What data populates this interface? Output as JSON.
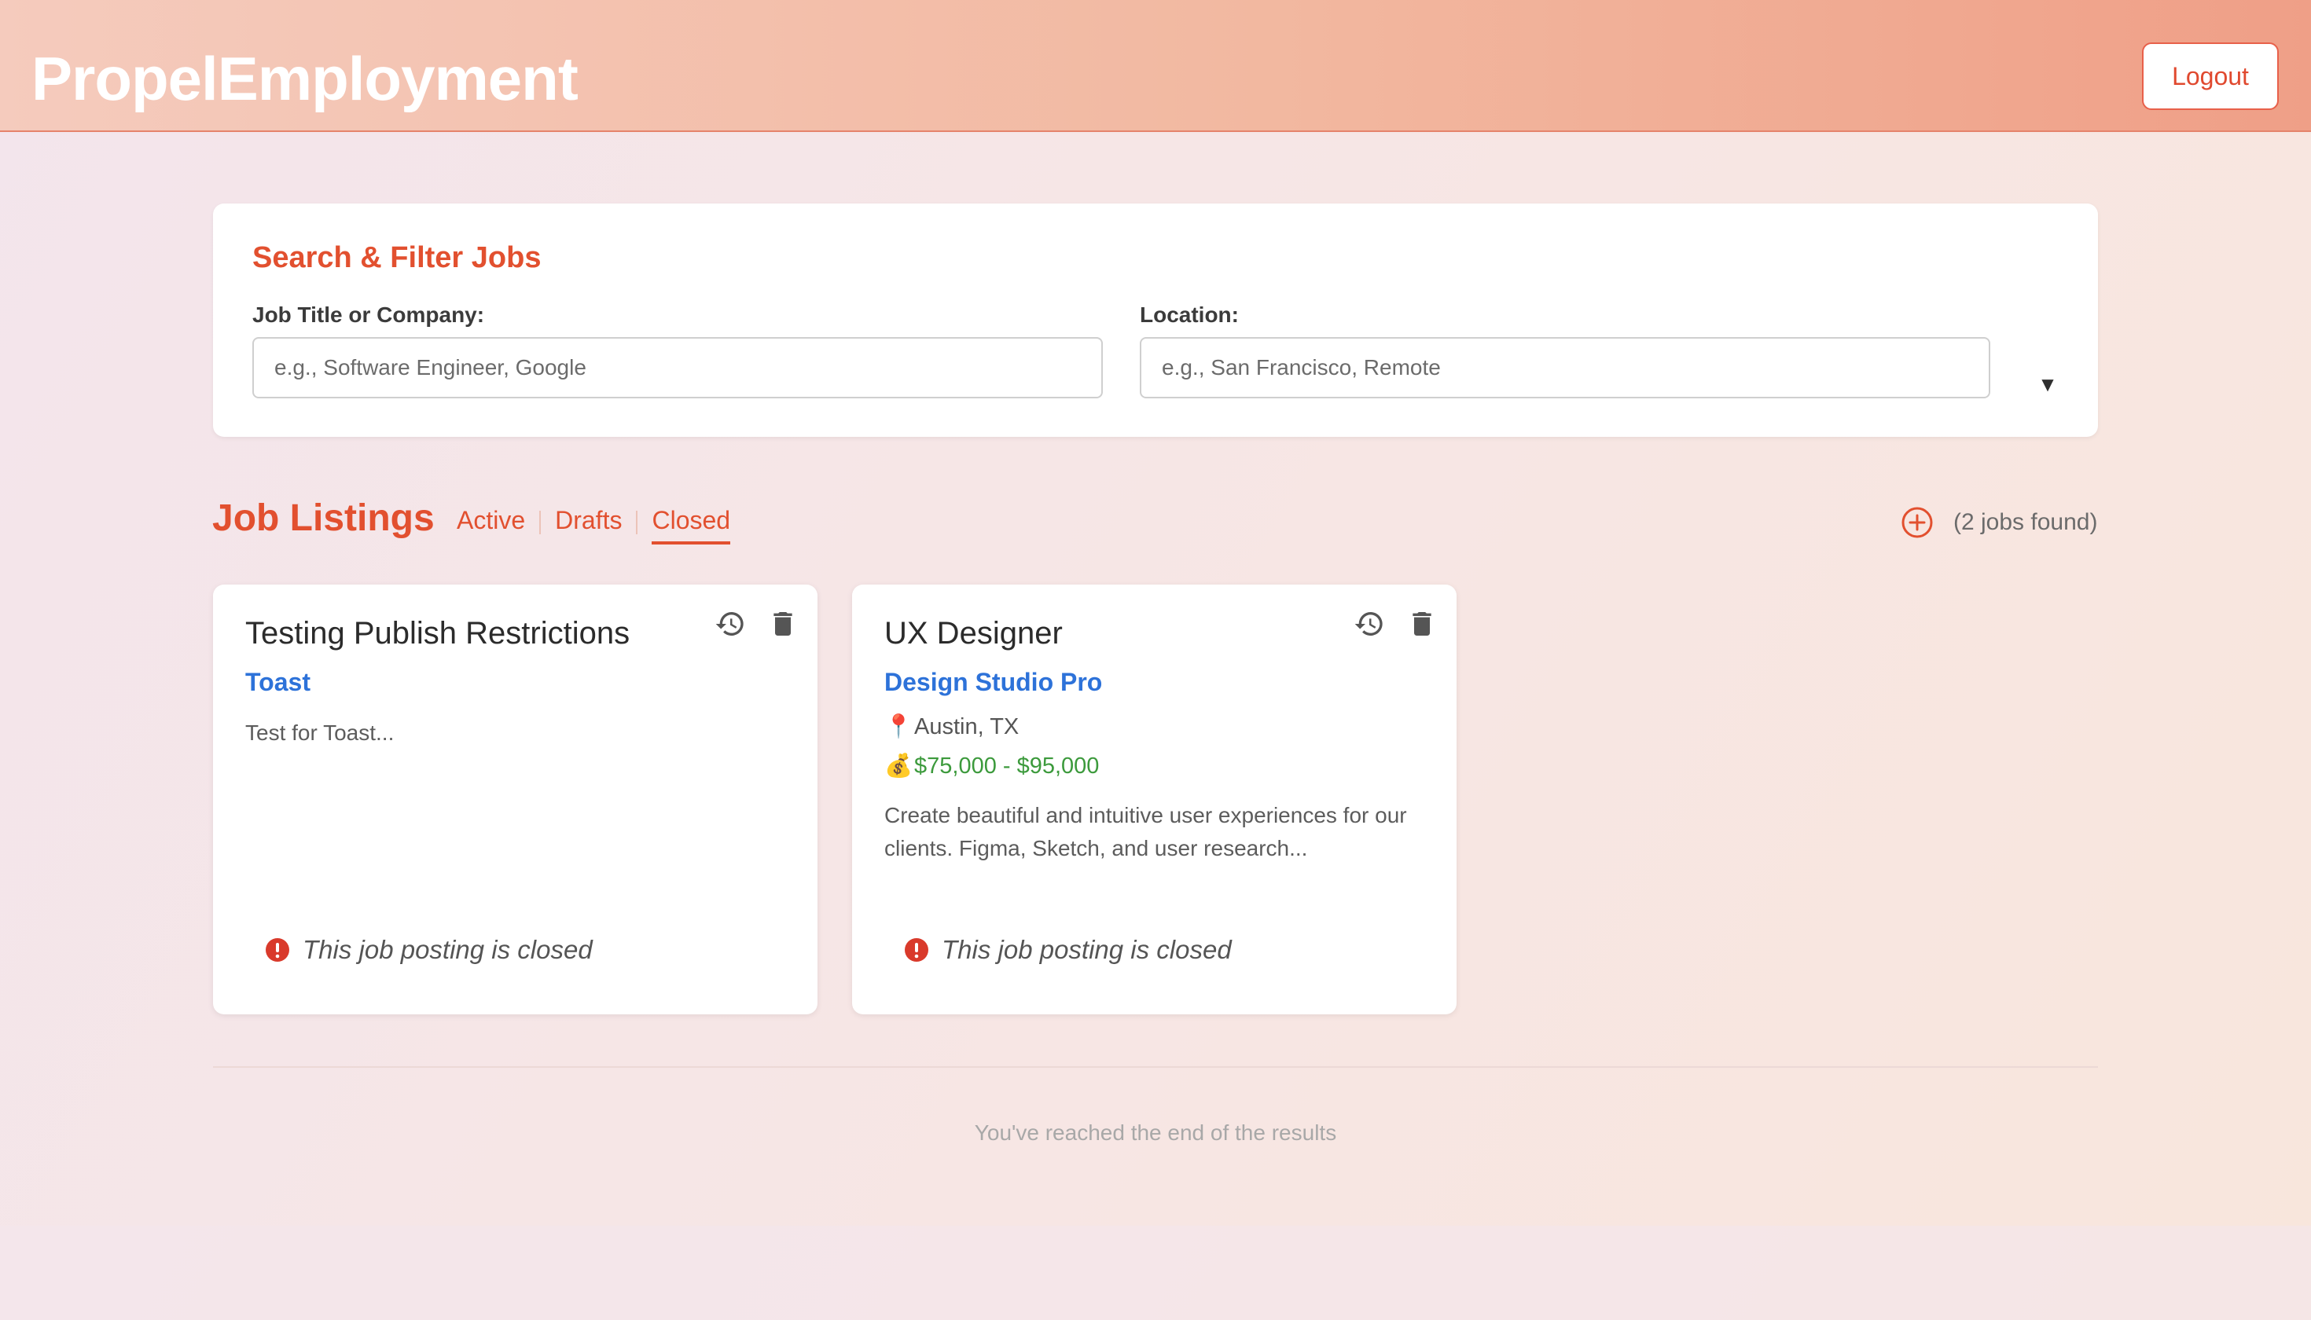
{
  "header": {
    "brand": "PropelEmployment",
    "logout_label": "Logout"
  },
  "search": {
    "title": "Search & Filter Jobs",
    "title_label": "Job Title or Company:",
    "title_placeholder": "e.g., Software Engineer, Google",
    "location_label": "Location:",
    "location_placeholder": "e.g., San Francisco, Remote",
    "toggle_icon": "▼"
  },
  "listings": {
    "title": "Job Listings",
    "tabs": [
      {
        "label": "Active",
        "selected": false
      },
      {
        "label": "Drafts",
        "selected": false
      },
      {
        "label": "Closed",
        "selected": true
      }
    ],
    "count_text": "(2 jobs found)",
    "add_icon": "plus-circle-icon"
  },
  "jobs": [
    {
      "title": "Testing Publish Restrictions",
      "company": "Toast",
      "description": "Test for Toast...",
      "closed_text": "This job posting is closed"
    },
    {
      "title": "UX Designer",
      "company": "Design Studio Pro",
      "location_icon": "📍",
      "location": "Austin, TX",
      "salary_icon": "💰",
      "salary": "$75,000 - $95,000",
      "description": "Create beautiful and intuitive user experiences for our clients. Figma, Sketch, and user research...",
      "closed_text": "This job posting is closed"
    }
  ],
  "footer": {
    "end_text": "You've reached the end of the results"
  },
  "colors": {
    "accent": "#e2502f",
    "link": "#2d72d9",
    "salary": "#3c9a3c",
    "closed": "#d93a2b"
  }
}
